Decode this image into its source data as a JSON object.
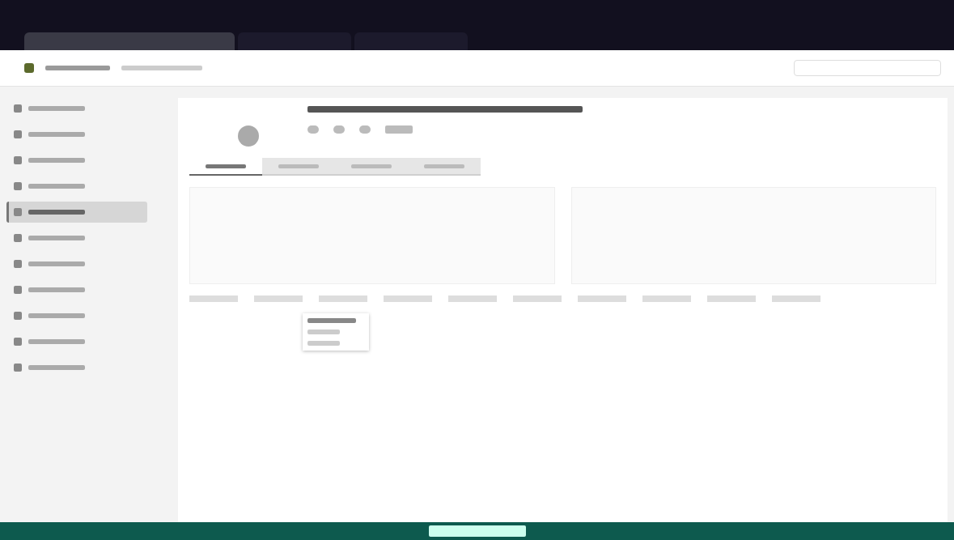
{
  "browser": {
    "tabs": [
      {
        "selected": true
      },
      {
        "selected": false
      },
      {
        "selected": false
      }
    ]
  },
  "sidebar": {
    "items": [
      {
        "selected": false
      },
      {
        "selected": false
      },
      {
        "selected": false
      },
      {
        "selected": false
      },
      {
        "selected": true
      },
      {
        "selected": false
      },
      {
        "selected": false
      },
      {
        "selected": false
      },
      {
        "selected": false
      },
      {
        "selected": false
      },
      {
        "selected": false
      }
    ]
  },
  "page_tabs": [
    {
      "selected": true
    },
    {
      "selected": false
    },
    {
      "selected": false
    },
    {
      "selected": false
    }
  ],
  "toolbar_buttons": [
    {
      "kind": "icon"
    },
    {
      "kind": "icon"
    },
    {
      "kind": "icon"
    },
    {
      "kind": "text"
    }
  ],
  "bottom_tabs": [
    {
      "selected": false
    },
    {
      "selected": false
    },
    {
      "selected": false
    },
    {
      "selected": false
    },
    {
      "selected": false
    },
    {
      "selected": false
    },
    {
      "selected": false
    },
    {
      "selected": false
    },
    {
      "selected": false
    },
    {
      "selected": false
    }
  ],
  "menu": {
    "open": true,
    "items": [
      {
        "selected": true
      },
      {
        "selected": false
      },
      {
        "selected": false
      }
    ]
  }
}
